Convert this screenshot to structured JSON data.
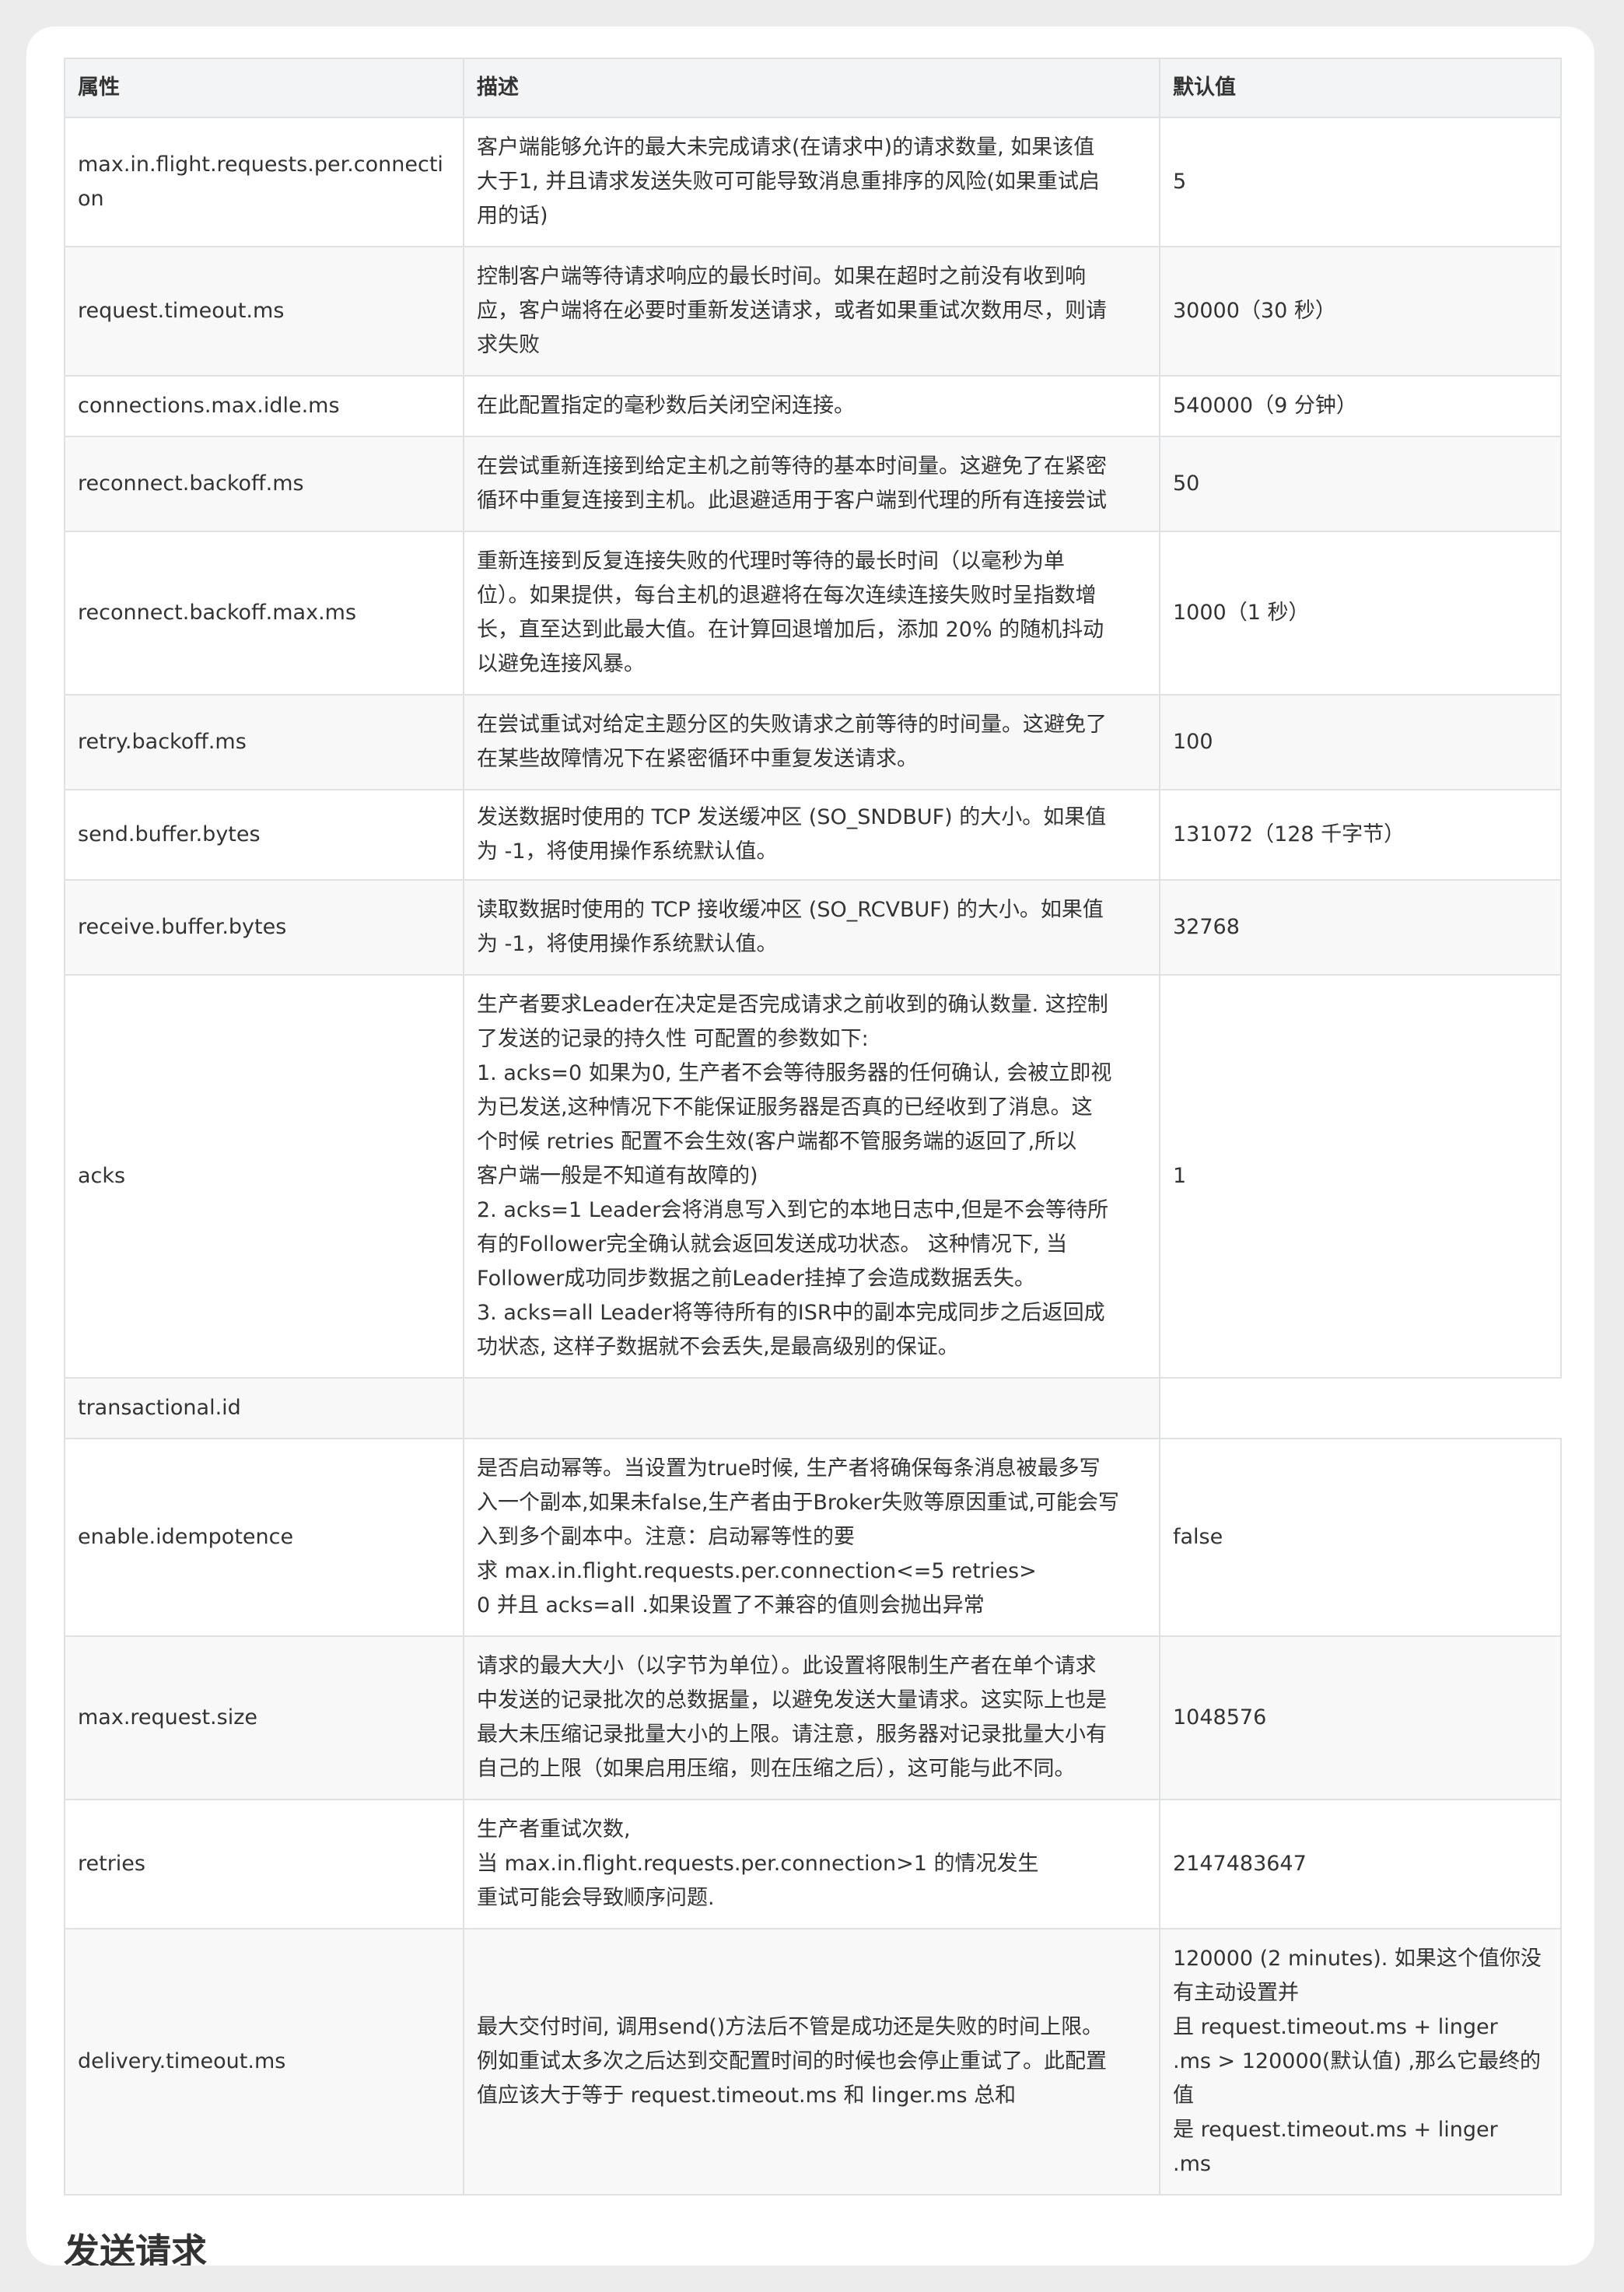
{
  "table": {
    "headers": [
      "属性",
      "描述",
      "默认值"
    ],
    "rows": [
      {
        "name": "max.in.flight.requests.per.connection",
        "description": "客户端能够允许的最大未完成请求(在请求中)的请求数量, 如果该值\n大于1, 并且请求发送失败可可能导致消息重排序的风险(如果重试启\n用的话)",
        "default": "5"
      },
      {
        "name": "request.timeout.ms",
        "description": "控制客户端等待请求响应的最长时间。如果在超时之前没有收到响\n应，客户端将在必要时重新发送请求，或者如果重试次数用尽，则请\n求失败",
        "default": "30000（30 秒）"
      },
      {
        "name": "connections.max.idle.ms",
        "description": "在此配置指定的毫秒数后关闭空闲连接。",
        "default": "540000（9 分钟）"
      },
      {
        "name": "reconnect.backoff.ms",
        "description": "在尝试重新连接到给定主机之前等待的基本时间量。这避免了在紧密\n循环中重复连接到主机。此退避适用于客户端到代理的所有连接尝试",
        "default": "50"
      },
      {
        "name": "reconnect.backoff.max.ms",
        "description": "重新连接到反复连接失败的代理时等待的最长时间（以毫秒为单\n位）。如果提供，每台主机的退避将在每次连续连接失败时呈指数增\n长，直至达到此最大值。在计算回退增加后，添加 20% 的随机抖动\n以避免连接风暴。",
        "default": "1000（1 秒）"
      },
      {
        "name": "retry.backoff.ms",
        "description": "在尝试重试对给定主题分区的失败请求之前等待的时间量。这避免了\n在某些故障情况下在紧密循环中重复发送请求。",
        "default": "100"
      },
      {
        "name": "send.buffer.bytes",
        "description": "发送数据时使用的 TCP 发送缓冲区 (SO_SNDBUF) 的大小。如果值\n为 -1，将使用操作系统默认值。",
        "default": "131072（128 千字节）"
      },
      {
        "name": "receive.buffer.bytes",
        "description": "读取数据时使用的 TCP 接收缓冲区 (SO_RCVBUF) 的大小。如果值\n为 -1，将使用操作系统默认值。",
        "default": "32768"
      },
      {
        "name": "acks",
        "description": "生产者要求Leader在决定是否完成请求之前收到的确认数量. 这控制\n了发送的记录的持久性 可配置的参数如下:\n1. acks=0 如果为0, 生产者不会等待服务器的任何确认, 会被立即视\n为已发送,这种情况下不能保证服务器是否真的已经收到了消息。这\n个时候 retries 配置不会生效(客户端都不管服务端的返回了,所以\n客户端一般是不知道有故障的)\n2. acks=1 Leader会将消息写入到它的本地日志中,但是不会等待所\n有的Follower完全确认就会返回发送成功状态。 这种情况下, 当\nFollower成功同步数据之前Leader挂掉了会造成数据丢失。\n3. acks=all Leader将等待所有的ISR中的副本完成同步之后返回成\n功状态, 这样子数据就不会丢失,是最高级别的保证。",
        "default": "1"
      },
      {
        "name": "transactional.id",
        "description": "",
        "default": ""
      },
      {
        "name": "enable.idempotence",
        "description": "是否启动幂等。当设置为true时候, 生产者将确保每条消息被最多写\n入一个副本,如果未false,生产者由于Broker失败等原因重试,可能会写\n入到多个副本中。注意：启动幂等性的要\n求 max.in.flight.requests.per.connection<=5 retries>\n0 并且 acks=all .如果设置了不兼容的值则会抛出异常",
        "default": "false"
      },
      {
        "name": "max.request.size",
        "description": "请求的最大大小（以字节为单位）。此设置将限制生产者在单个请求\n中发送的记录批次的总数据量，以避免发送大量请求。这实际上也是\n最大未压缩记录批量大小的上限。请注意，服务器对记录批量大小有\n自己的上限（如果启用压缩，则在压缩之后），这可能与此不同。",
        "default": "1048576"
      },
      {
        "name": "retries",
        "description": "生产者重试次数,\n当 max.in.flight.requests.per.connection>1 的情况发生\n重试可能会导致顺序问题.",
        "default": "2147483647"
      },
      {
        "name": "delivery.timeout.ms",
        "description": "最大交付时间, 调用send()方法后不管是成功还是失败的时间上限。\n例如重试太多次之后达到交配置时间的时候也会停止重试了。此配置\n值应该大于等于 request.timeout.ms 和 linger.ms 总和",
        "default": "120000 (2 minutes). 如果这个值你没\n有主动设置并\n且 request.timeout.ms + linger\n.ms > 120000(默认值) ,那么它最终的\n值\n是 request.timeout.ms + linger\n.ms"
      }
    ]
  },
  "section": {
    "title": "发送请求"
  }
}
